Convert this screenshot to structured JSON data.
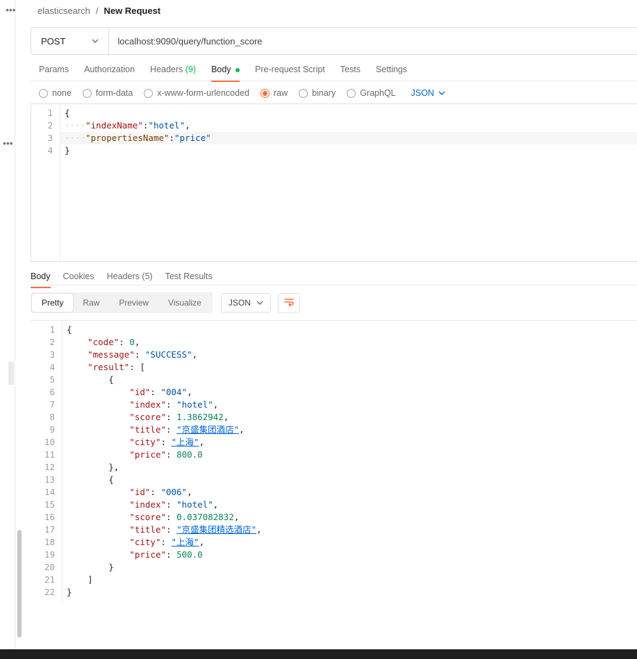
{
  "breadcrumb": {
    "collection": "elasticsearch",
    "request": "New Request"
  },
  "method": "POST",
  "url": "localhost:9090/query/function_score",
  "req_tabs": {
    "params": "Params",
    "auth": "Authorization",
    "headers": "Headers",
    "headers_count": "(9)",
    "body": "Body",
    "prerequest": "Pre-request Script",
    "tests": "Tests",
    "settings": "Settings"
  },
  "body_types": {
    "none": "none",
    "form_data": "form-data",
    "xwww": "x-www-form-urlencoded",
    "raw": "raw",
    "binary": "binary",
    "graphql": "GraphQL",
    "json": "JSON"
  },
  "request_body": {
    "l1": "{",
    "l2a": "\"indexName\"",
    "l2b": ":",
    "l2c": "\"hotel\"",
    "l2d": ",",
    "l3a": "\"propertiesName\"",
    "l3b": ":",
    "l3c": "\"price\"",
    "l4": "}"
  },
  "resp_tabs": {
    "body": "Body",
    "cookies": "Cookies",
    "headers": "Headers",
    "headers_count": "(5)",
    "test_results": "Test Results"
  },
  "view_modes": {
    "pretty": "Pretty",
    "raw": "Raw",
    "preview": "Preview",
    "visualize": "Visualize",
    "json": "JSON"
  },
  "response": {
    "code_key": "\"code\"",
    "code_val": "0",
    "message_key": "\"message\"",
    "message_val": "\"SUCCESS\"",
    "result_key": "\"result\"",
    "items": [
      {
        "id_key": "\"id\"",
        "id_val": "\"004\"",
        "index_key": "\"index\"",
        "index_val": "\"hotel\"",
        "score_key": "\"score\"",
        "score_val": "1.3862942",
        "title_key": "\"title\"",
        "title_val": "\"京盛集团酒店\"",
        "city_key": "\"city\"",
        "city_val": "\"上海\"",
        "price_key": "\"price\"",
        "price_val": "800.0"
      },
      {
        "id_key": "\"id\"",
        "id_val": "\"006\"",
        "index_key": "\"index\"",
        "index_val": "\"hotel\"",
        "score_key": "\"score\"",
        "score_val": "0.037082832",
        "title_key": "\"title\"",
        "title_val": "\"京盛集团精选酒店\"",
        "city_key": "\"city\"",
        "city_val": "\"上海\"",
        "price_key": "\"price\"",
        "price_val": "500.0"
      }
    ]
  }
}
